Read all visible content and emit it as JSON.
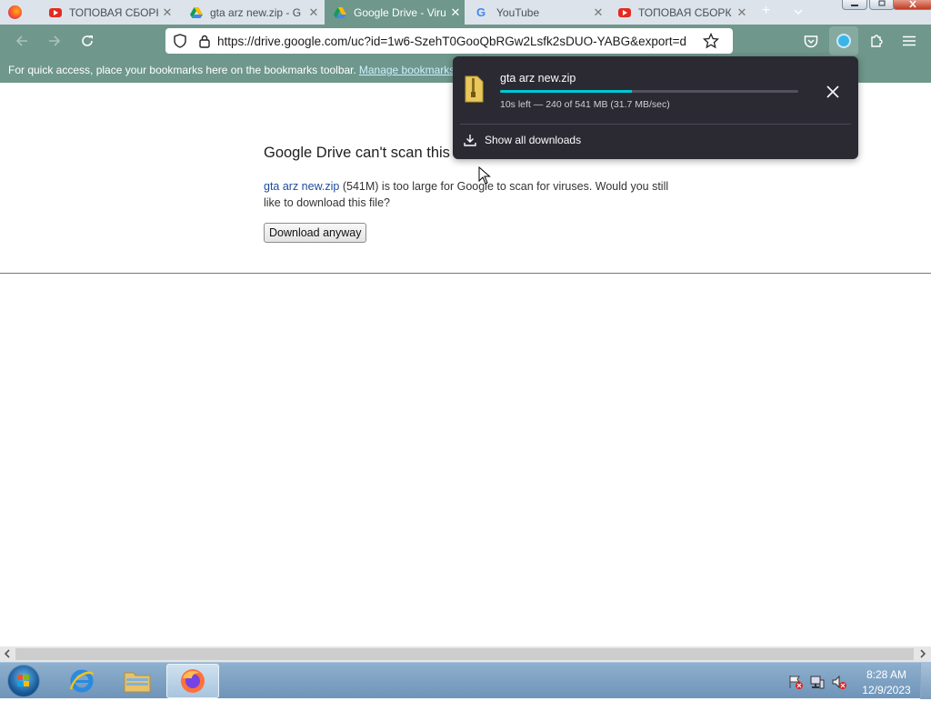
{
  "tabs": [
    {
      "title": "ТОПОВАЯ СБОРК",
      "icon": "youtube-icon",
      "active": false
    },
    {
      "title": "gta arz new.zip - G",
      "icon": "google-drive-icon",
      "active": false
    },
    {
      "title": "Google Drive - Viru",
      "icon": "google-drive-icon",
      "active": true
    },
    {
      "title": "YouTube",
      "icon": "google-icon",
      "active": false
    },
    {
      "title": "ТОПОВАЯ СБОРК",
      "icon": "youtube-icon",
      "active": false
    }
  ],
  "tab_close_glyph": "✕",
  "new_tab_glyph": "+",
  "toolbar": {
    "url": "https://drive.google.com/uc?id=1w6-SzehT0GooQbRGw2Lsfk2sDUO-YABG&export=d"
  },
  "bookmarks_bar": {
    "text": "For quick access, place your bookmarks here on the bookmarks toolbar.",
    "link": "Manage bookmarks"
  },
  "page": {
    "heading": "Google Drive can't scan this file for viruses.",
    "file_link": "gta arz new.zip",
    "body_text": " (541M) is too large for Google to scan for viruses. Would you still like to download this file?",
    "button": "Download anyway"
  },
  "downloads_panel": {
    "filename": "gta arz new.zip",
    "progress": 0.443,
    "status": "10s left — 240 of 541 MB (31.7 MB/sec)",
    "show_all": "Show all downloads"
  },
  "taskbar": {
    "time": "8:28 AM",
    "date": "12/9/2023"
  },
  "colors": {
    "toolbar": "#6f978b",
    "panel_bg": "#2b2a33",
    "progress": "#00c8d7",
    "link": "#1c4e9c"
  }
}
